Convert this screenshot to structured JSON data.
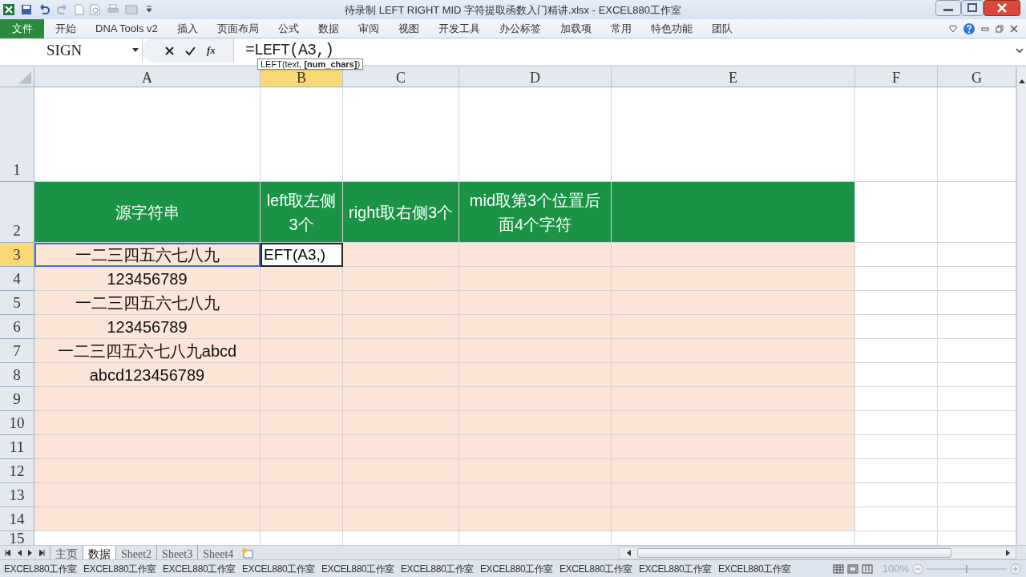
{
  "window": {
    "title": "待录制 LEFT RIGHT MID 字符提取函数入门精讲.xlsx - EXCEL880工作室"
  },
  "file_tab": "文件",
  "ribbon_tabs": [
    "开始",
    "DNA Tools v2",
    "插入",
    "页面布局",
    "公式",
    "数据",
    "审阅",
    "视图",
    "开发工具",
    "办公标签",
    "加载项",
    "常用",
    "特色功能",
    "团队"
  ],
  "formula_bar": {
    "name_box": "SIGN",
    "function_button": "fx",
    "formula": "=LEFT(A3,)",
    "tooltip": "LEFT(text, **[num_chars]**)"
  },
  "columns": [
    {
      "label": "A",
      "selected": false,
      "referenced": true
    },
    {
      "label": "B",
      "selected": true,
      "referenced": false
    },
    {
      "label": "C",
      "selected": false,
      "referenced": false
    },
    {
      "label": "D",
      "selected": false,
      "referenced": false
    },
    {
      "label": "E",
      "selected": false,
      "referenced": false
    },
    {
      "label": "F",
      "selected": false,
      "referenced": false
    },
    {
      "label": "G",
      "selected": false,
      "referenced": false
    }
  ],
  "rows": [
    {
      "header": "1",
      "kind": "blank",
      "selected": false
    },
    {
      "header": "2",
      "kind": "header",
      "selected": false,
      "cells": [
        "源字符串",
        "left取左侧3个",
        "right取右侧3个",
        "mid取第3个位置后面4个字符"
      ]
    },
    {
      "header": "3",
      "kind": "data",
      "selected": true,
      "cells": [
        "一二三四五六七八九",
        "EFT(A3,)"
      ]
    },
    {
      "header": "4",
      "kind": "data",
      "selected": false,
      "cells": [
        "123456789"
      ]
    },
    {
      "header": "5",
      "kind": "data",
      "selected": false,
      "cells": [
        "一二三四五六七八九"
      ]
    },
    {
      "header": "6",
      "kind": "data",
      "selected": false,
      "cells": [
        "123456789"
      ]
    },
    {
      "header": "7",
      "kind": "data",
      "selected": false,
      "cells": [
        "一二三四五六七八九abcd"
      ]
    },
    {
      "header": "8",
      "kind": "data",
      "selected": false,
      "cells": [
        "abcd123456789"
      ]
    },
    {
      "header": "9",
      "kind": "data",
      "selected": false
    },
    {
      "header": "10",
      "kind": "data",
      "selected": false
    },
    {
      "header": "11",
      "kind": "data",
      "selected": false
    },
    {
      "header": "12",
      "kind": "data",
      "selected": false
    },
    {
      "header": "13",
      "kind": "data",
      "selected": false
    },
    {
      "header": "14",
      "kind": "data",
      "selected": false
    },
    {
      "header": "15",
      "kind": "blank",
      "selected": false
    }
  ],
  "sheet_tabs": [
    {
      "label": "主页",
      "selected": false
    },
    {
      "label": "数据",
      "selected": true
    },
    {
      "label": "Sheet2",
      "selected": false
    },
    {
      "label": "Sheet3",
      "selected": false
    },
    {
      "label": "Sheet4",
      "selected": false
    }
  ],
  "status_bar": {
    "items": [
      "EXCEL880工作室",
      "EXCEL880工作室",
      "EXCEL880工作室",
      "EXCEL880工作室",
      "EXCEL880工作室",
      "EXCEL880工作室",
      "EXCEL880工作室",
      "EXCEL880工作室",
      "EXCEL880工作室",
      "EXCEL880工作室"
    ],
    "zoom": "100%",
    "zoom_slider": {
      "level": 0.5
    }
  }
}
